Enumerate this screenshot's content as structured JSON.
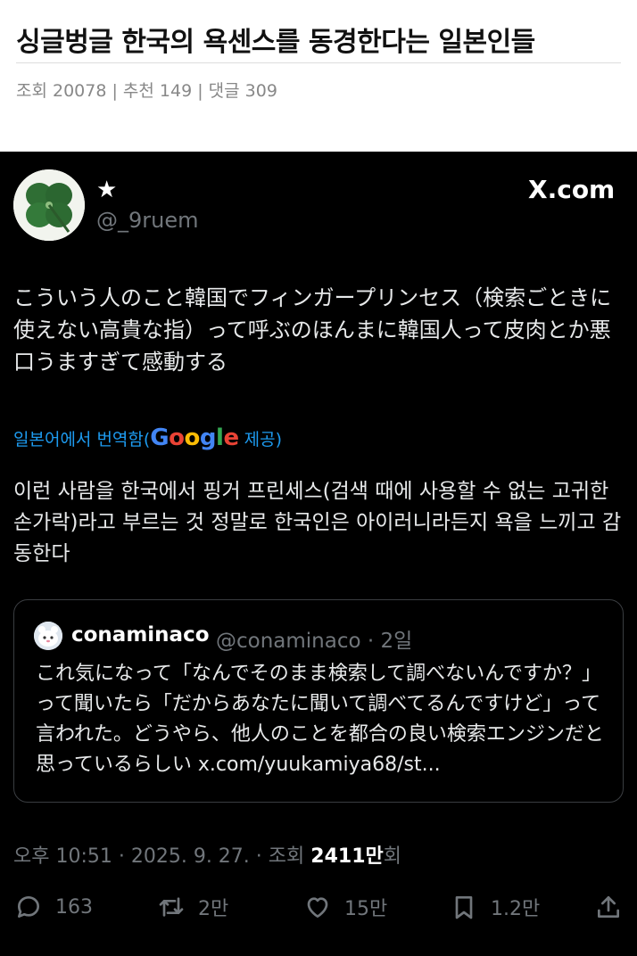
{
  "post": {
    "title": "싱글벙글 한국의 욕센스를 동경한다는 일본인들",
    "meta": "조회 20078 | 추천 149 | 댓글 309"
  },
  "tweet": {
    "display_name": "★",
    "handle": "@_9ruem",
    "platform_label": "X.com",
    "text": "こういう人のこと韓国でフィンガープリンセス（検索ごときに使えない高貴な指）って呼ぶのほんまに韓国人って皮肉とか悪口うますぎて感動する",
    "translation": {
      "label_prefix": "일본어에서 번역함(",
      "provider": "Google",
      "label_suffix": " 제공)",
      "text": "이런 사람을 한국에서 핑거 프린세스(검색 때에 사용할 수 없는 고귀한 손가락)라고 부르는 것 정말로 한국인은 아이러니라든지 욕을 느끼고 감동한다"
    },
    "quote": {
      "name": "conaminaco",
      "handle_time": "@conaminaco · 2일",
      "text": "これ気になって「なんでそのまま検索して調べないんですか？」って聞いたら「だからあなたに聞いて調べてるんですけど」って言われた。どうやら、他人のことを都合の良い検索エンジンだと思っているらしい x.com/yuukamiya68/st..."
    },
    "timestamp": {
      "prefix": "오후 10:51 · 2025. 9. 27. · 조회 ",
      "views": "2411만",
      "suffix": "회"
    },
    "actions": {
      "replies": "163",
      "retweets": "2만",
      "likes": "15만",
      "bookmarks": "1.2만"
    }
  },
  "icons": {
    "avatar": "four-leaf-clover",
    "quote_avatar": "cartoon-character",
    "reply": "speech-bubble-icon",
    "retweet": "retweet-icon",
    "like": "heart-icon",
    "bookmark": "bookmark-icon",
    "share": "share-icon"
  },
  "colors": {
    "background": "#000000",
    "text": "#e7e9ea",
    "muted": "#71767b",
    "link": "#1d9bf0"
  }
}
